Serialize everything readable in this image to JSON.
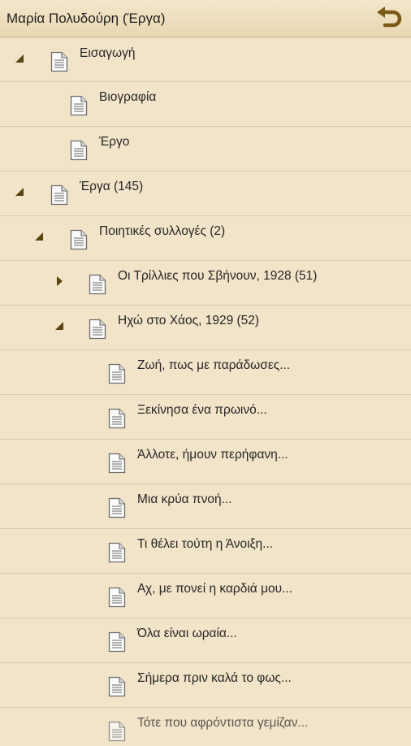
{
  "header": {
    "title": "Μαρία Πολυδούρη (Έργα)",
    "back_icon": "undo-arrow-icon",
    "accent_color": "#7a5a14"
  },
  "colors": {
    "background": "#f2e4c8",
    "divider": "#dccba7",
    "expander": "#5a4410"
  },
  "tree": {
    "items": [
      {
        "label": "Εισαγωγή",
        "level": 0,
        "expander": "expanded",
        "icon": "document-icon"
      },
      {
        "label": "Βιογραφία",
        "level": 1,
        "expander": "none",
        "icon": "document-icon"
      },
      {
        "label": "Έργο",
        "level": 1,
        "expander": "none",
        "icon": "document-icon"
      },
      {
        "label": "Έργα (145)",
        "level": 0,
        "expander": "expanded",
        "icon": "document-icon"
      },
      {
        "label": "Ποιητικές συλλογές (2)",
        "level": 1,
        "expander": "expanded",
        "icon": "document-icon"
      },
      {
        "label": "Οι Τρίλλιες που Σβήνουν, 1928 (51)",
        "level": 2,
        "expander": "collapsed",
        "icon": "document-icon"
      },
      {
        "label": "Ηχώ στο Χάος, 1929 (52)",
        "level": 2,
        "expander": "expanded",
        "icon": "document-icon"
      },
      {
        "label": "Ζωή, πως με παράδωσες...",
        "level": 3,
        "expander": "none",
        "icon": "document-icon"
      },
      {
        "label": "Ξεκίνησα ένα πρωινό...",
        "level": 3,
        "expander": "none",
        "icon": "document-icon"
      },
      {
        "label": "Άλλοτε, ήμουν περήφανη...",
        "level": 3,
        "expander": "none",
        "icon": "document-icon"
      },
      {
        "label": "Μια κρύα πνοή...",
        "level": 3,
        "expander": "none",
        "icon": "document-icon"
      },
      {
        "label": "Τι θέλει τούτη η Άνοιξη...",
        "level": 3,
        "expander": "none",
        "icon": "document-icon"
      },
      {
        "label": "Αχ, με πονεί η καρδιά μου...",
        "level": 3,
        "expander": "none",
        "icon": "document-icon"
      },
      {
        "label": "Όλα είναι ωραία...",
        "level": 3,
        "expander": "none",
        "icon": "document-icon"
      },
      {
        "label": "Σήμερα πριν καλά το φως...",
        "level": 3,
        "expander": "none",
        "icon": "document-icon"
      },
      {
        "label": "Τότε που αφρόντιστα γεμίζαν...",
        "level": 3,
        "expander": "none",
        "icon": "document-icon"
      }
    ]
  }
}
